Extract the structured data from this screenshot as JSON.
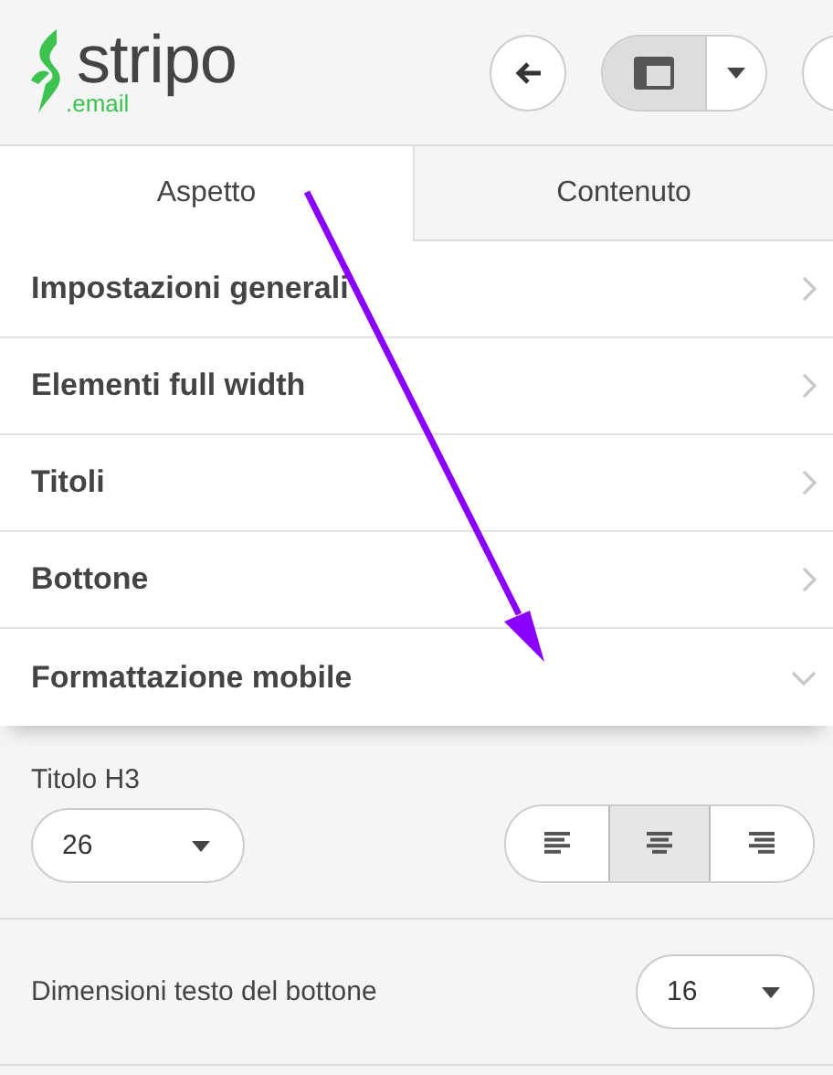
{
  "header": {
    "logo": {
      "name": "stripo",
      "suffix": ".email"
    }
  },
  "tabs": [
    {
      "label": "Aspetto",
      "selected": true
    },
    {
      "label": "Contenuto",
      "selected": false
    }
  ],
  "sections": [
    {
      "label": "Impostazioni generali",
      "expanded": false
    },
    {
      "label": "Elementi full width",
      "expanded": false
    },
    {
      "label": "Titoli",
      "expanded": false
    },
    {
      "label": "Bottone",
      "expanded": false
    },
    {
      "label": "Formattazione mobile",
      "expanded": true
    }
  ],
  "mobile": {
    "heading": {
      "label": "Titolo H3",
      "value": "26"
    },
    "align": [
      {
        "kind": "left",
        "selected": false
      },
      {
        "kind": "center",
        "selected": true
      },
      {
        "kind": "right",
        "selected": false
      }
    ],
    "button_text": {
      "label": "Dimensioni testo del bottone",
      "value": "16"
    }
  }
}
